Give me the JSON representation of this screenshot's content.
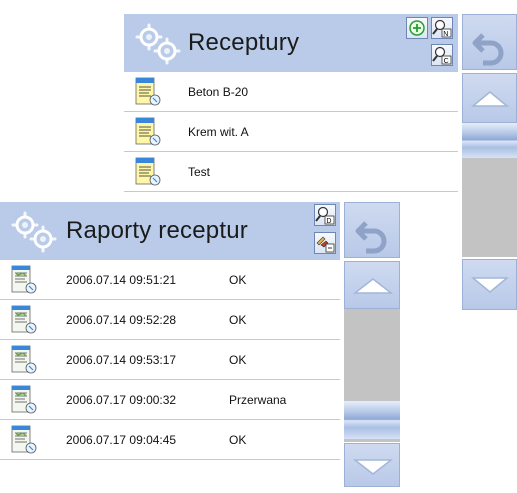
{
  "recipes_panel": {
    "title": "Receptury",
    "add_button_icon": "plus-icon",
    "search_n_icon": "magnifier-n-icon",
    "search_c_icon": "magnifier-c-icon",
    "items": [
      {
        "name": "Beton B-20"
      },
      {
        "name": "Krem wit. A"
      },
      {
        "name": "Test"
      }
    ]
  },
  "reports_panel": {
    "title": "Raporty receptur",
    "search_d_icon": "magnifier-d-icon",
    "export_icon": "export-icon",
    "rows": [
      {
        "datetime": "2006.07.14 09:51:21",
        "status": "OK"
      },
      {
        "datetime": "2006.07.14 09:52:28",
        "status": "OK"
      },
      {
        "datetime": "2006.07.14 09:53:17",
        "status": "OK"
      },
      {
        "datetime": "2006.07.17 09:00:32",
        "status": "Przerwana"
      },
      {
        "datetime": "2006.07.17 09:04:45",
        "status": "OK"
      }
    ]
  },
  "colors": {
    "header": "#b9cbe9",
    "side_button": "#c3d2ee",
    "scroll_track": "#c3c3c3"
  }
}
